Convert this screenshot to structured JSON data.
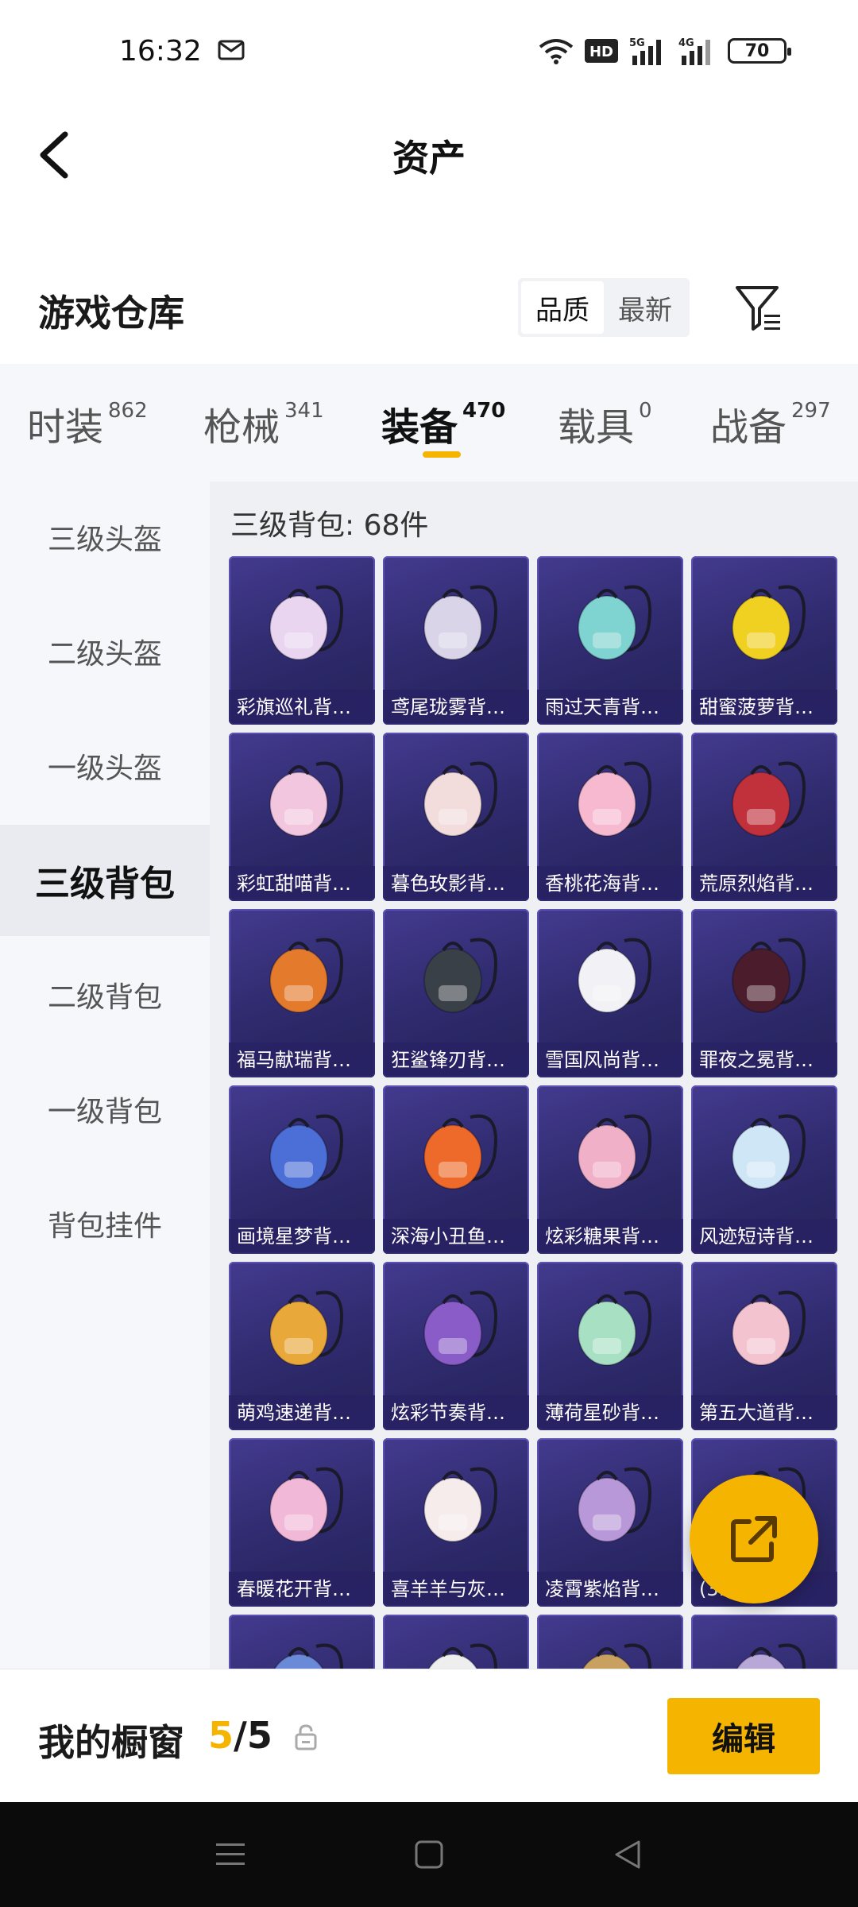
{
  "status_bar": {
    "time": "16:32",
    "network": [
      "HD",
      "5G",
      "4G"
    ],
    "battery": "70",
    "icons": [
      "mail-icon",
      "wifi-icon",
      "signal-icon",
      "battery-icon"
    ]
  },
  "header": {
    "title": "资产",
    "back_icon": "chevron-left-icon"
  },
  "warehouse": {
    "title": "游戏仓库",
    "sort_options": [
      {
        "label": "品质",
        "active": true
      },
      {
        "label": "最新",
        "active": false
      }
    ],
    "filter_icon": "filter-icon"
  },
  "tabs": [
    {
      "label": "时装",
      "count": "862",
      "active": false
    },
    {
      "label": "枪械",
      "count": "341",
      "active": false
    },
    {
      "label": "装备",
      "count": "470",
      "active": true
    },
    {
      "label": "载具",
      "count": "0",
      "active": false
    },
    {
      "label": "战备",
      "count": "297",
      "active": false
    }
  ],
  "sidebar": {
    "items": [
      {
        "label": "三级头盔",
        "active": false
      },
      {
        "label": "二级头盔",
        "active": false
      },
      {
        "label": "一级头盔",
        "active": false
      },
      {
        "label": "三级背包",
        "active": true
      },
      {
        "label": "二级背包",
        "active": false
      },
      {
        "label": "一级背包",
        "active": false
      },
      {
        "label": "背包挂件",
        "active": false
      }
    ]
  },
  "content": {
    "header": "三级背包: 68件",
    "items": [
      {
        "name": "彩旗巡礼背包...",
        "color": "#e9d5f0"
      },
      {
        "name": "鸢尾珑雾背包...",
        "color": "#d9d4e8"
      },
      {
        "name": "雨过天青背包...",
        "color": "#7fd3d0"
      },
      {
        "name": "甜蜜菠萝背包...",
        "color": "#f0d020"
      },
      {
        "name": "彩虹甜喵背包...",
        "color": "#f3c6df"
      },
      {
        "name": "暮色玫影背包...",
        "color": "#f2dcdc"
      },
      {
        "name": "香桃花海背包...",
        "color": "#f6b9cf"
      },
      {
        "name": "荒原烈焰背包...",
        "color": "#c0313b"
      },
      {
        "name": "福马献瑞背包...",
        "color": "#e47a2c"
      },
      {
        "name": "狂鲨锋刃背包...",
        "color": "#3a4048"
      },
      {
        "name": "雪国风尚背包...",
        "color": "#f2f2f6"
      },
      {
        "name": "罪夜之冕背包...",
        "color": "#4a1c2c"
      },
      {
        "name": "画境星梦背包...",
        "color": "#4b6fd6"
      },
      {
        "name": "深海小丑鱼背...",
        "color": "#ee6a2a"
      },
      {
        "name": "炫彩糖果背包...",
        "color": "#f0b0c8"
      },
      {
        "name": "风迹短诗背包...",
        "color": "#cfe6f6"
      },
      {
        "name": "萌鸡速递背包...",
        "color": "#e8a83a"
      },
      {
        "name": "炫彩节奏背包...",
        "color": "#8a5cc8"
      },
      {
        "name": "薄荷星砂背包...",
        "color": "#a8e0c4"
      },
      {
        "name": "第五大道背包...",
        "color": "#f3c3cf"
      },
      {
        "name": "春暖花开背包...",
        "color": "#f2b8d8"
      },
      {
        "name": "喜羊羊与灰太...",
        "color": "#f6ecec"
      },
      {
        "name": "凌霄紫焰背包...",
        "color": "#b898d8"
      },
      {
        "name": "(3...",
        "color": "#d8c098"
      },
      {
        "name": "",
        "color": "#6a8ad8"
      },
      {
        "name": "",
        "color": "#eeeeee"
      },
      {
        "name": "",
        "color": "#c8a060"
      },
      {
        "name": "",
        "color": "#b8a8d8"
      }
    ]
  },
  "fab": {
    "icon": "share-external-icon",
    "color": "#f5b400"
  },
  "showcase": {
    "title": "我的橱窗",
    "used": "5",
    "separator": "/",
    "total": "5",
    "lock_icon": "lock-icon",
    "edit_label": "编辑"
  },
  "nav_bar": {
    "icons": [
      "menu-icon",
      "home-square-icon",
      "back-triangle-icon"
    ]
  },
  "colors": {
    "accent": "#f5b400",
    "card_bg": "#2e2a6c"
  }
}
